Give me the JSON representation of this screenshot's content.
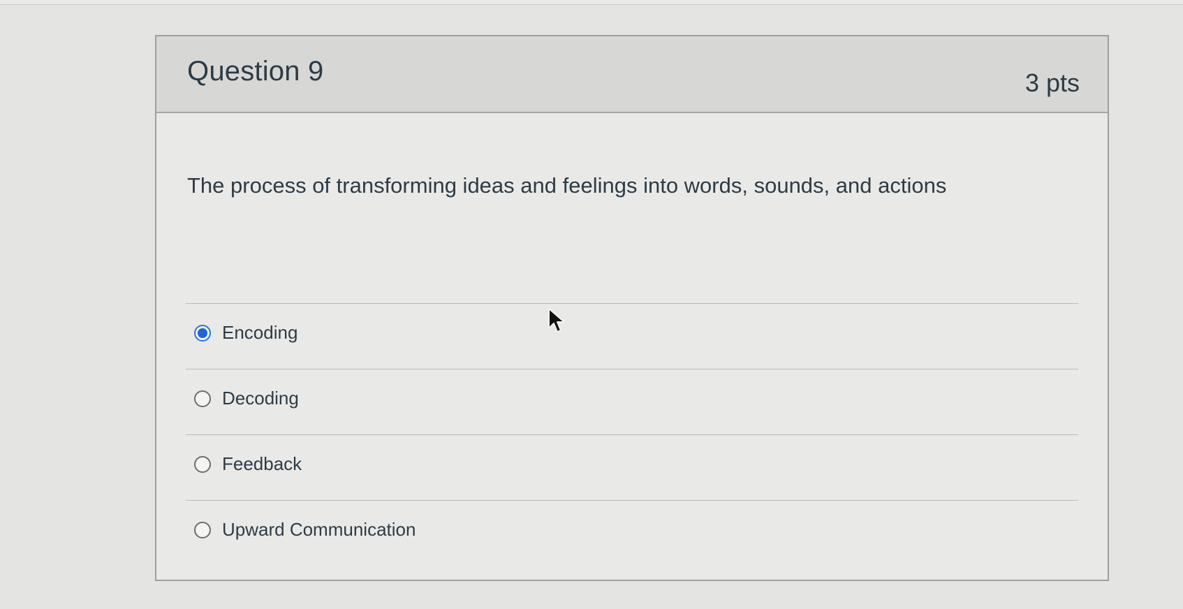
{
  "question": {
    "title": "Question 9",
    "points": "3 pts",
    "text": "The process of transforming ideas and feelings into words, sounds, and actions"
  },
  "answers": [
    {
      "label": "Encoding",
      "selected": true
    },
    {
      "label": "Decoding",
      "selected": false
    },
    {
      "label": "Feedback",
      "selected": false
    },
    {
      "label": "Upward Communication",
      "selected": false
    }
  ],
  "colors": {
    "selected_radio": "#2064d8",
    "text": "#2d3b45"
  },
  "icons": {
    "cursor": "mouse-pointer-icon"
  }
}
